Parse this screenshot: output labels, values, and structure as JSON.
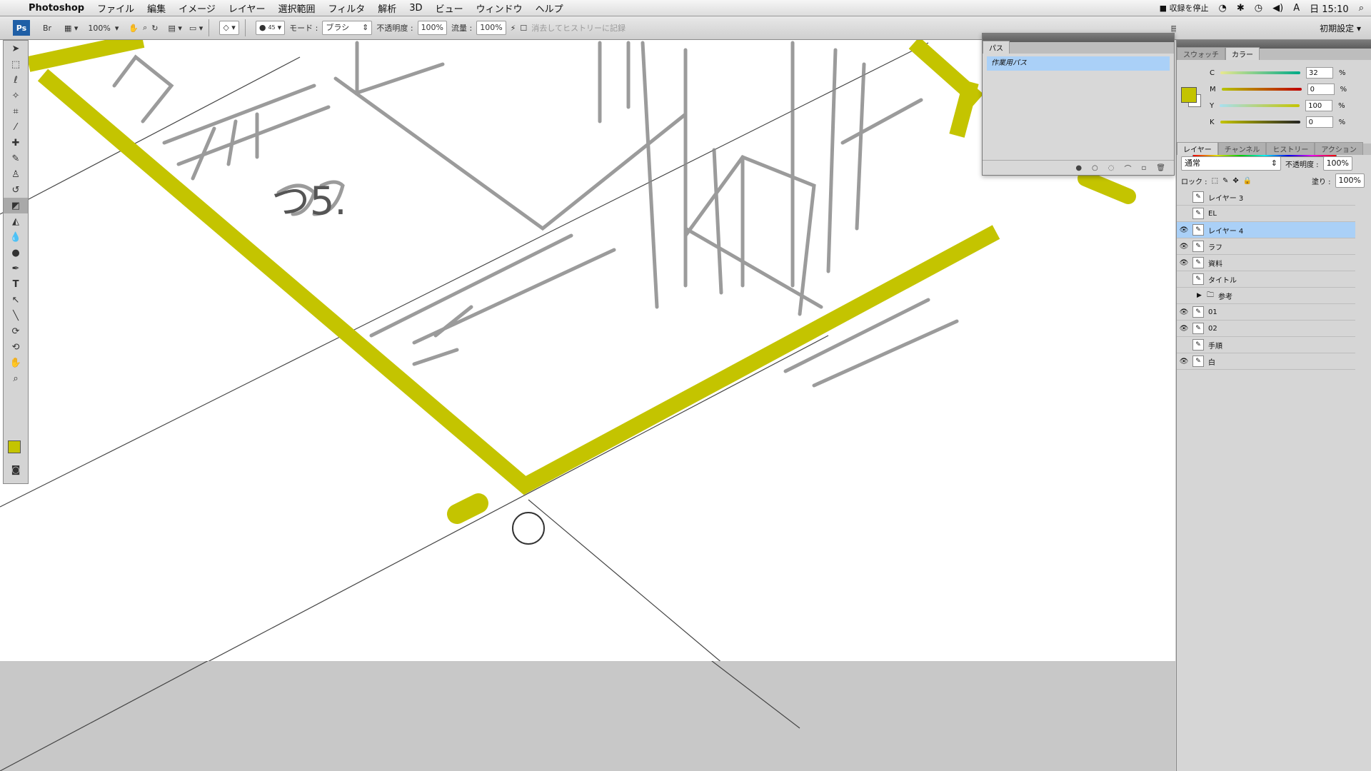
{
  "menubar": {
    "app": "Photoshop",
    "items": [
      "ファイル",
      "編集",
      "イメージ",
      "レイヤー",
      "選択範囲",
      "フィルタ",
      "解析",
      "3D",
      "ビュー",
      "ウィンドウ",
      "ヘルプ"
    ],
    "status": "■ 収録を停止",
    "clock": "日 15:10"
  },
  "options": {
    "zoom": "100%",
    "brush_size": "45",
    "mode_label": "モード :",
    "mode_value": "ブラシ",
    "opacity_label": "不透明度 :",
    "opacity_value": "100%",
    "flow_label": "流量 :",
    "flow_value": "100%",
    "history_label": "消去してヒストリーに記録",
    "workspace": "初期設定 ▾"
  },
  "paths_panel": {
    "tab": "パス",
    "item": "作業用パス"
  },
  "color_panel": {
    "tabs": [
      "スウォッチ",
      "カラー"
    ],
    "channels": [
      {
        "name": "C",
        "value": "32",
        "unit": "%"
      },
      {
        "name": "M",
        "value": "0",
        "unit": "%"
      },
      {
        "name": "Y",
        "value": "100",
        "unit": "%"
      },
      {
        "name": "K",
        "value": "0",
        "unit": "%"
      }
    ],
    "foreground": "#c4c400"
  },
  "layers_panel": {
    "tabs": [
      "レイヤー",
      "チャンネル",
      "ヒストリー",
      "アクション"
    ],
    "blend_mode": "通常",
    "opacity_label": "不透明度 :",
    "opacity_value": "100%",
    "lock_label": "ロック :",
    "fill_label": "塗り :",
    "fill_value": "100%",
    "layers": [
      {
        "name": "レイヤー 3",
        "visible": false,
        "selected": false
      },
      {
        "name": "EL",
        "visible": false,
        "selected": false
      },
      {
        "name": "レイヤー 4",
        "visible": true,
        "selected": true
      },
      {
        "name": "ラフ",
        "visible": true,
        "selected": false
      },
      {
        "name": "資料",
        "visible": true,
        "selected": false
      },
      {
        "name": "タイトル",
        "visible": false,
        "selected": false
      },
      {
        "name": "参考",
        "visible": false,
        "selected": false,
        "group": true
      },
      {
        "name": "01",
        "visible": true,
        "selected": false
      },
      {
        "name": "02",
        "visible": true,
        "selected": false
      },
      {
        "name": "手順",
        "visible": false,
        "selected": false
      },
      {
        "name": "白",
        "visible": true,
        "selected": false
      }
    ]
  },
  "canvas": {
    "sketch_text": "つ5."
  }
}
